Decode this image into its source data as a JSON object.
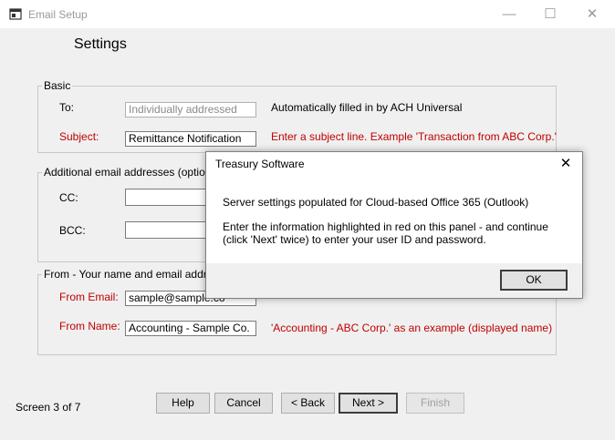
{
  "window": {
    "title": "Email Setup",
    "minimize": "—",
    "maximize": "☐",
    "close": "✕"
  },
  "page_title": "Settings",
  "basic": {
    "group_title": "Basic",
    "to_label": "To:",
    "to_value": "Individually addressed",
    "to_hint": "Automatically filled in by ACH Universal",
    "subject_label": "Subject:",
    "subject_value": "Remittance Notification",
    "subject_hint": "Enter a subject line. Example 'Transaction from ABC Corp.'"
  },
  "additional": {
    "group_title": "Additional email addresses (optional - ra",
    "cc_label": "CC:",
    "cc_value": "",
    "bcc_label": "BCC:",
    "bcc_value": ""
  },
  "from": {
    "group_title": "From - Your name and email address",
    "email_label": "From Email:",
    "email_value": "sample@sample.co",
    "name_label": "From Name:",
    "name_value": "Accounting - Sample Co.",
    "name_hint": "'Accounting - ABC Corp.' as an example (displayed name)"
  },
  "footer": {
    "screen": "Screen 3 of 7",
    "help": "Help",
    "cancel": "Cancel",
    "back": "< Back",
    "next": "Next >",
    "finish": "Finish"
  },
  "dialog": {
    "title": "Treasury Software",
    "close": "✕",
    "line1": "Server settings populated for Cloud-based Office 365 (Outlook)",
    "line2": "Enter the information highlighted in red on this panel - and continue",
    "line3": "(click 'Next' twice) to enter your user ID and password.",
    "ok": "OK"
  },
  "colors": {
    "required_label": "#c00000",
    "background": "#f0f0f0"
  }
}
